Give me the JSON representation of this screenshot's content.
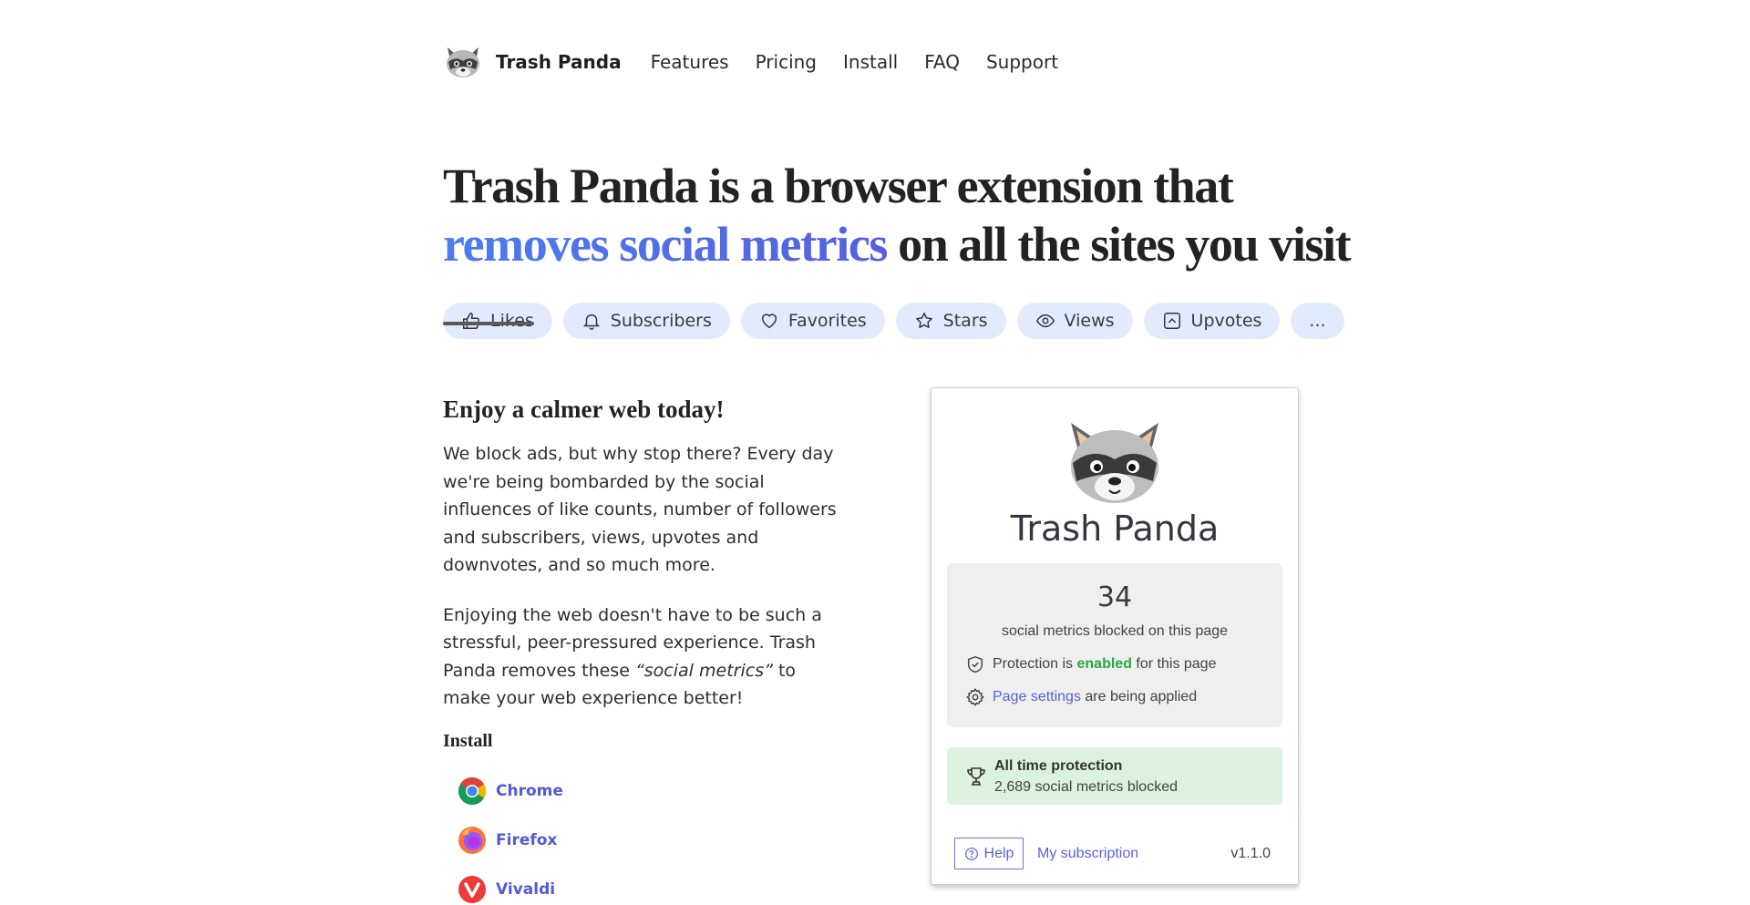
{
  "nav": {
    "brand": "Trash Panda",
    "links": [
      "Features",
      "Pricing",
      "Install",
      "FAQ",
      "Support"
    ]
  },
  "hero": {
    "headline_line1": "Trash Panda is a browser extension that",
    "headline_accent": "removes social metrics",
    "headline_rest": " on all the sites you visit"
  },
  "pills": [
    {
      "label": "Likes",
      "icon": "thumbs-up-icon",
      "struck": true
    },
    {
      "label": "Subscribers",
      "icon": "bell-icon"
    },
    {
      "label": "Favorites",
      "icon": "heart-icon"
    },
    {
      "label": "Stars",
      "icon": "star-icon"
    },
    {
      "label": "Views",
      "icon": "eye-icon"
    },
    {
      "label": "Upvotes",
      "icon": "upvote-icon"
    },
    {
      "label": "..."
    }
  ],
  "intro": {
    "heading": "Enjoy a calmer web today!",
    "para1": "We block ads, but why stop there? Every day we're being bombarded by the social influences of like counts, number of followers and subscribers, views, upvotes and downvotes, and so much more.",
    "para2_before": "Enjoying the web doesn't have to be such a stressful, peer-pressured experience. Trash Panda removes these ",
    "para2_em": "“social metrics”",
    "para2_after": " to make your web experience better!",
    "install_heading": "Install",
    "browsers": [
      {
        "name": "Chrome",
        "icon": "chrome-icon"
      },
      {
        "name": "Firefox",
        "icon": "firefox-icon"
      },
      {
        "name": "Vivaldi",
        "icon": "vivaldi-icon"
      }
    ]
  },
  "popup": {
    "title": "Trash Panda",
    "count": "34",
    "count_caption": "social metrics blocked on this page",
    "protection_prefix": "Protection is ",
    "protection_status": "enabled",
    "protection_suffix": " for this page",
    "settings_link": "Page settings",
    "settings_suffix": " are being applied",
    "all_time_title": "All time protection",
    "all_time_value": "2,689 social metrics blocked",
    "help_label": "Help",
    "subscription_label": "My subscription",
    "version": "v1.1.0"
  },
  "colors": {
    "accent_start": "#4c7cf0",
    "accent_end": "#5560dd",
    "pill_bg": "#e2ebfd",
    "link": "#5b63d6",
    "enabled": "#2aa742",
    "all_time_bg": "#dcf1df"
  }
}
